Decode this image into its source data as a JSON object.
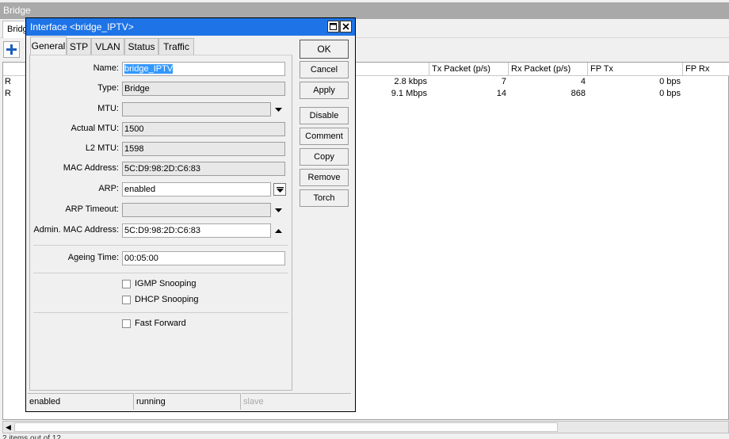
{
  "bridge_window": {
    "title": "Bridge",
    "tab": "Bridg",
    "grid": {
      "columns": [
        "Tx Packet (p/s)",
        "Rx Packet (p/s)",
        "FP Tx",
        "FP Rx"
      ],
      "rows": [
        {
          "flag": "R",
          "rate": "2.8 kbps",
          "tx_packet": "7",
          "rx_packet": "4",
          "fp_tx": "0 bps"
        },
        {
          "flag": "R",
          "rate": "9.1 Mbps",
          "tx_packet": "14",
          "rx_packet": "868",
          "fp_tx": "0 bps"
        }
      ]
    },
    "status_text": "2 items out of 12"
  },
  "dialog": {
    "title": "Interface <bridge_IPTV>",
    "tabs": [
      "General",
      "STP",
      "VLAN",
      "Status",
      "Traffic"
    ],
    "active_tab": "General",
    "fields": {
      "name": {
        "label": "Name:",
        "value": "bridge_IPTV"
      },
      "type": {
        "label": "Type:",
        "value": "Bridge"
      },
      "mtu": {
        "label": "MTU:",
        "value": ""
      },
      "actual_mtu": {
        "label": "Actual MTU:",
        "value": "1500"
      },
      "l2_mtu": {
        "label": "L2 MTU:",
        "value": "1598"
      },
      "mac_address": {
        "label": "MAC Address:",
        "value": "5C:D9:98:2D:C6:83"
      },
      "arp": {
        "label": "ARP:",
        "value": "enabled"
      },
      "arp_timeout": {
        "label": "ARP Timeout:",
        "value": ""
      },
      "admin_mac": {
        "label": "Admin. MAC Address:",
        "value": "5C:D9:98:2D:C6:83"
      },
      "ageing_time": {
        "label": "Ageing Time:",
        "value": "00:05:00"
      }
    },
    "checkboxes": {
      "igmp_snooping": {
        "label": "IGMP Snooping",
        "checked": false
      },
      "dhcp_snooping": {
        "label": "DHCP Snooping",
        "checked": false
      },
      "fast_forward": {
        "label": "Fast Forward",
        "checked": false
      }
    },
    "buttons": {
      "ok": "OK",
      "cancel": "Cancel",
      "apply": "Apply",
      "disable": "Disable",
      "comment": "Comment",
      "copy": "Copy",
      "remove": "Remove",
      "torch": "Torch"
    },
    "status": {
      "enabled": "enabled",
      "running": "running",
      "slave": "slave"
    }
  },
  "colors": {
    "title_bar": "#1e74e6",
    "selection": "#3399ff",
    "add_icon": "#1b5eb8"
  }
}
